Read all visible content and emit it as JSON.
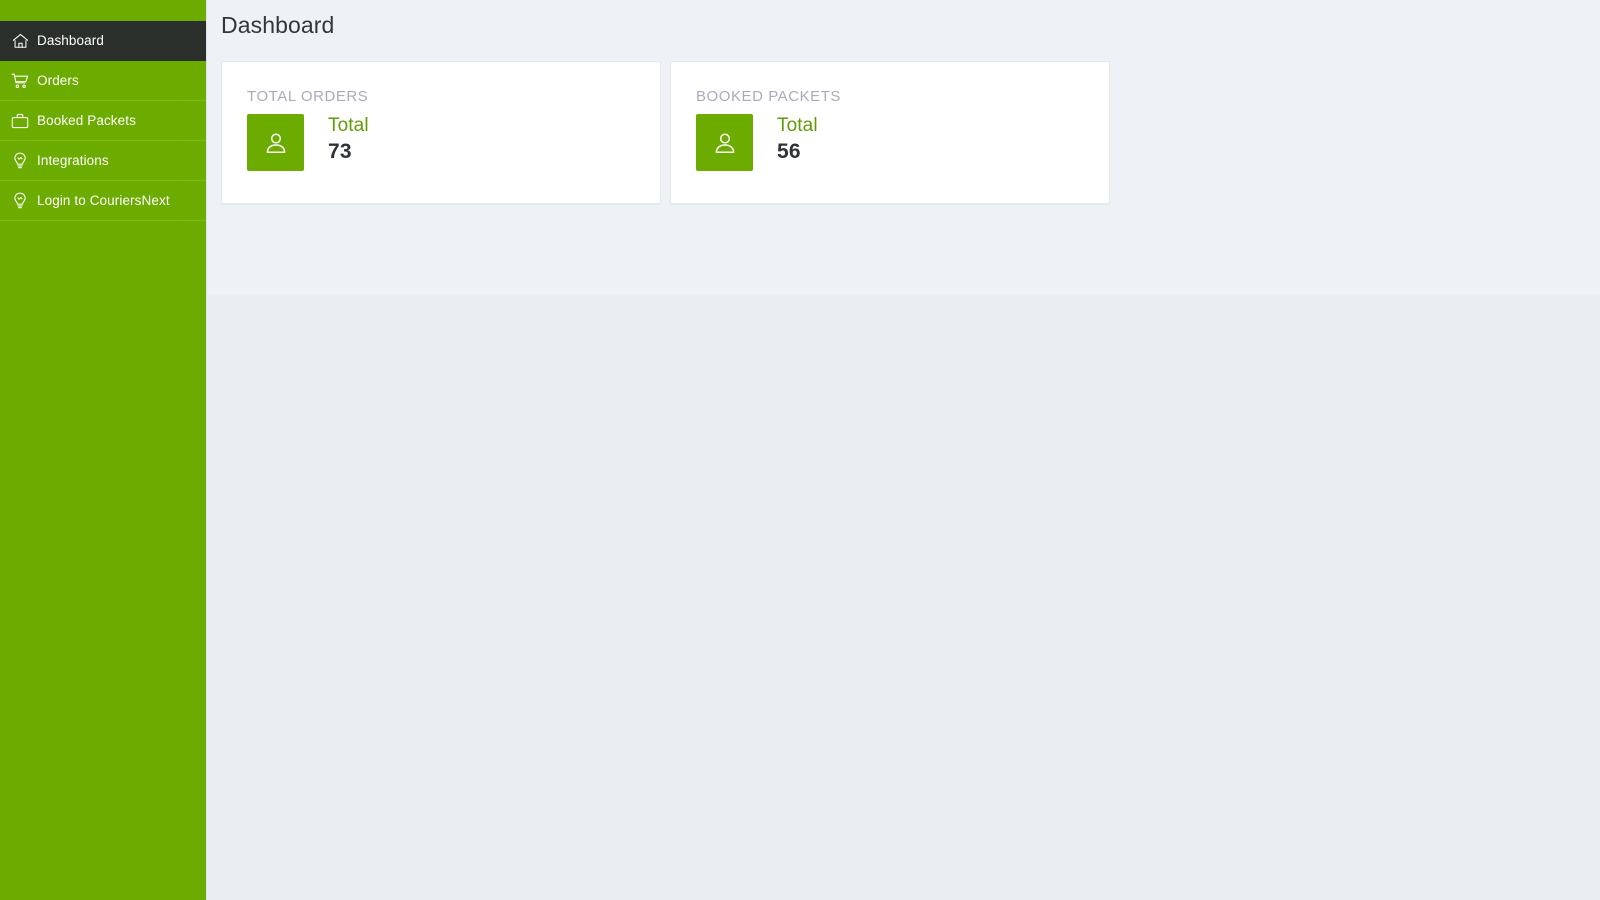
{
  "sidebar": {
    "accent_color": "#6cab00",
    "active_color": "#2b2f2c",
    "items": [
      {
        "label": "Dashboard",
        "icon": "home-icon",
        "active": true
      },
      {
        "label": "Orders",
        "icon": "cart-icon",
        "active": false
      },
      {
        "label": "Booked Packets",
        "icon": "briefcase-icon",
        "active": false
      },
      {
        "label": "Integrations",
        "icon": "bulb-icon",
        "active": false
      },
      {
        "label": "Login to CouriersNext",
        "icon": "bulb-icon",
        "active": false
      }
    ]
  },
  "main": {
    "page_title": "Dashboard",
    "cards": [
      {
        "title": "TOTAL ORDERS",
        "icon": "user-icon",
        "stat_label": "Total",
        "stat_value": "73"
      },
      {
        "title": "BOOKED PACKETS",
        "icon": "user-icon",
        "stat_label": "Total",
        "stat_value": "56"
      }
    ]
  },
  "colors": {
    "brand_green": "#6cab00",
    "stat_label_green": "#619b09",
    "card_title_gray": "#a7adb8",
    "page_bg": "#eef1f5",
    "active_nav": "#2b2f2c"
  }
}
